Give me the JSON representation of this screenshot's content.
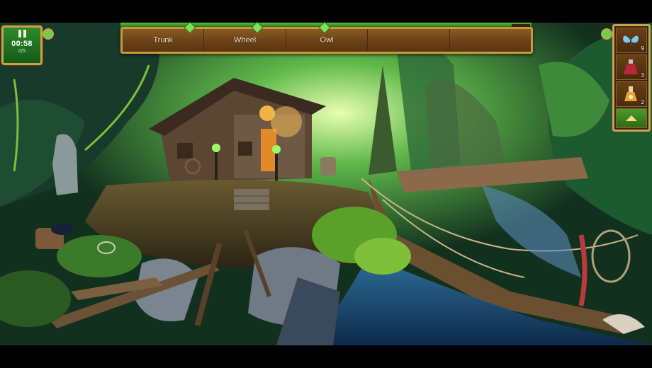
{
  "hud": {
    "timer": "00:58",
    "found_count": "0/5",
    "pause_icon": "pause-icon"
  },
  "item_list": {
    "items": [
      "Trunk",
      "Wheel",
      "Owl",
      "",
      ""
    ]
  },
  "inventory": {
    "slots": [
      {
        "icon": "butterfly-icon",
        "count": "9"
      },
      {
        "icon": "potion-bottle-icon",
        "count": "3"
      },
      {
        "icon": "flask-icon",
        "count": "2"
      }
    ],
    "scroll_icon": "scroll-up-icon"
  },
  "colors": {
    "frame_gold": "#c9a24a",
    "panel_brown": "#6a4116",
    "hud_green": "#2c8a2a"
  }
}
